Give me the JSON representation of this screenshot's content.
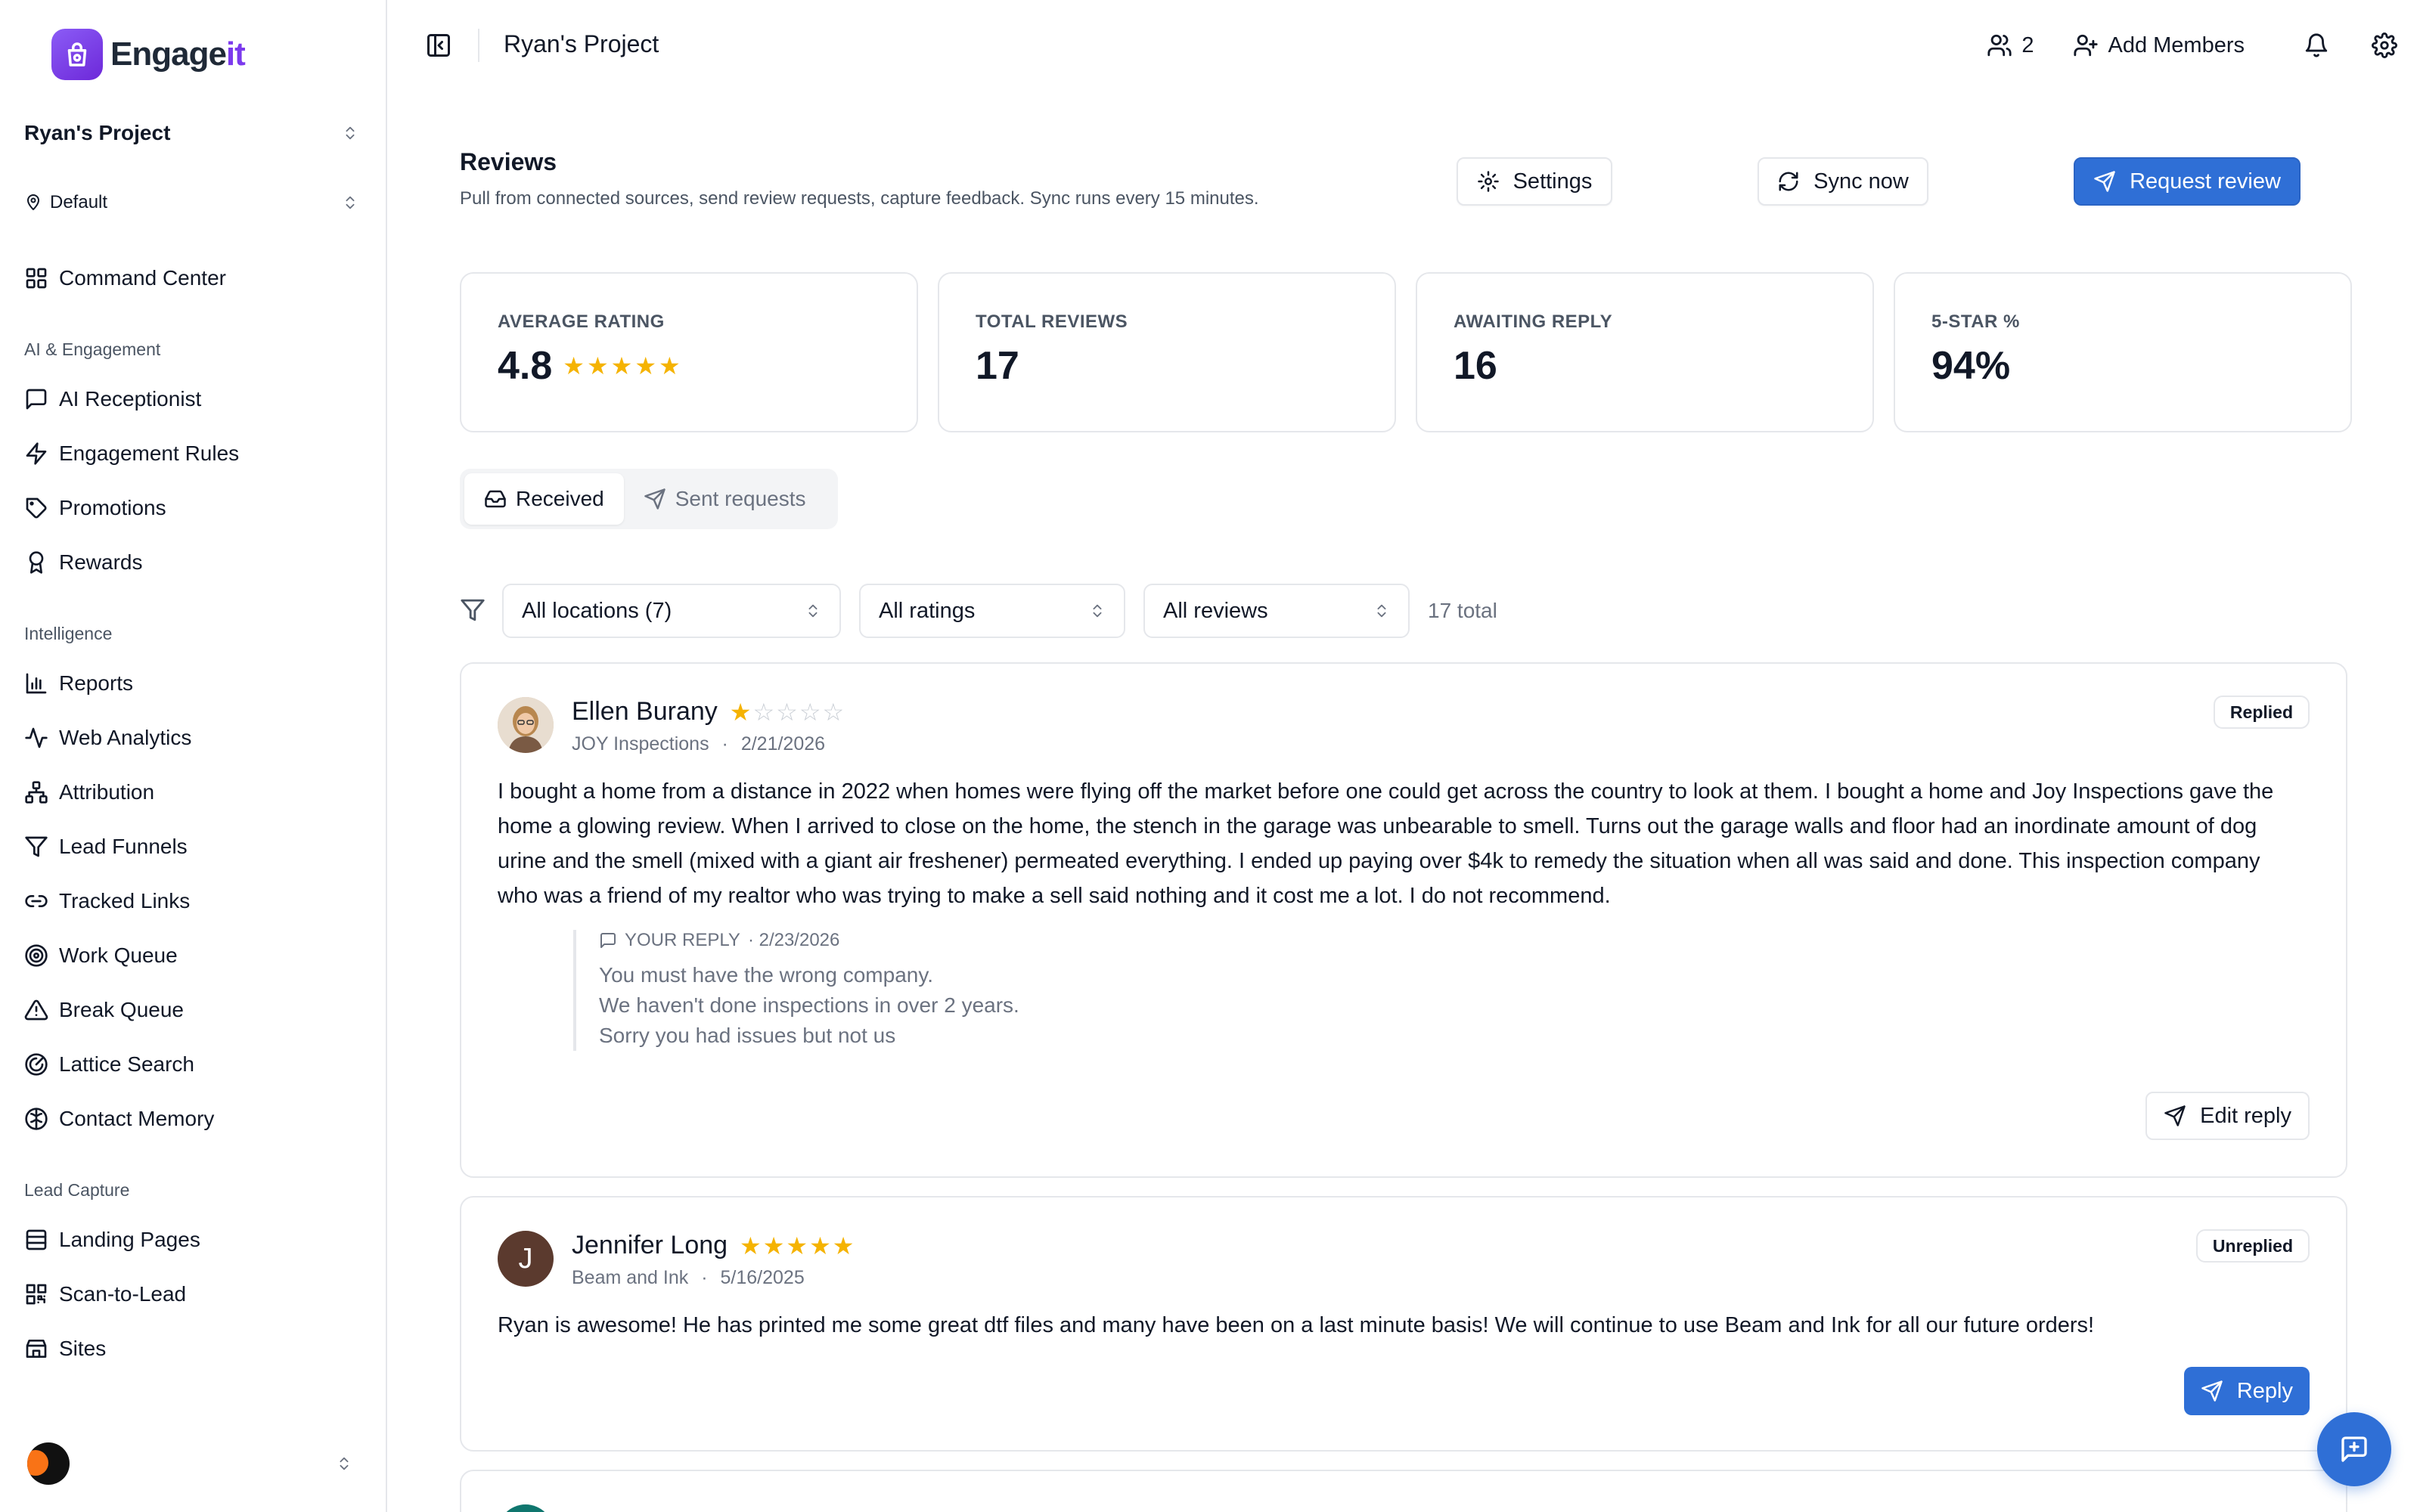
{
  "app": {
    "name_main": "Engage",
    "name_accent": "it"
  },
  "sidebar": {
    "project": "Ryan's Project",
    "location": "Default",
    "command_center": "Command Center",
    "groups": [
      {
        "label": "AI & Engagement",
        "items": [
          "AI Receptionist",
          "Engagement Rules",
          "Promotions",
          "Rewards"
        ]
      },
      {
        "label": "Intelligence",
        "items": [
          "Reports",
          "Web Analytics",
          "Attribution",
          "Lead Funnels",
          "Tracked Links",
          "Work Queue",
          "Break Queue",
          "Lattice Search",
          "Contact Memory"
        ]
      },
      {
        "label": "Lead Capture",
        "items": [
          "Landing Pages",
          "Scan-to-Lead",
          "Sites"
        ]
      }
    ]
  },
  "topbar": {
    "title": "Ryan's Project",
    "members_count": "2",
    "add_members": "Add Members"
  },
  "header": {
    "title": "Reviews",
    "subtitle": "Pull from connected sources, send review requests, capture feedback. Sync runs every 15 minutes.",
    "settings": "Settings",
    "sync": "Sync now",
    "request": "Request review"
  },
  "stats": {
    "average_rating": {
      "label": "AVERAGE RATING",
      "value": "4.8",
      "stars": 5
    },
    "total_reviews": {
      "label": "TOTAL REVIEWS",
      "value": "17"
    },
    "awaiting_reply": {
      "label": "AWAITING REPLY",
      "value": "16"
    },
    "five_star": {
      "label": "5-STAR %",
      "value": "94%"
    }
  },
  "tabs": {
    "received": "Received",
    "sent": "Sent requests"
  },
  "filters": {
    "locations": "All locations (7)",
    "ratings": "All ratings",
    "reviews": "All reviews",
    "total": "17 total"
  },
  "reviews": [
    {
      "name": "Ellen Burany",
      "rating": 1,
      "business": "JOY Inspections",
      "date": "2/21/2026",
      "status": "Replied",
      "text": "I bought a home from a distance in 2022 when homes were flying off the market before one could get across the country to look at them. I bought a home and Joy Inspections gave the home a glowing review. When I arrived to close on the home, the stench in the garage was unbearable to smell. Turns out the garage walls and floor had an inordinate amount of dog urine and the smell (mixed with a giant air freshener) permeated everything. I ended up paying over $4k to remedy the situation when all was said and done. This inspection company who was a friend of my realtor  who was trying to make a sell said nothing and it cost me a lot. I do not recommend.",
      "reply_label": "YOUR REPLY",
      "reply_date": "· 2/23/2026",
      "reply_lines": [
        "You must have the wrong company.",
        "We haven't done inspections in over 2 years.",
        "Sorry you had issues but not us"
      ],
      "action": "Edit reply"
    },
    {
      "name": "Jennifer Long",
      "initial": "J",
      "rating": 5,
      "business": "Beam and Ink",
      "date": "5/16/2025",
      "status": "Unreplied",
      "text": "Ryan is awesome! He has printed me some great dtf files and many have been on a last minute basis! We will continue to use Beam and Ink for all our future orders!",
      "action": "Reply"
    }
  ],
  "colors": {
    "primary": "#2f6fd6",
    "star": "#f5b301",
    "brand": "#7c3aed",
    "border": "#e5e7eb"
  }
}
